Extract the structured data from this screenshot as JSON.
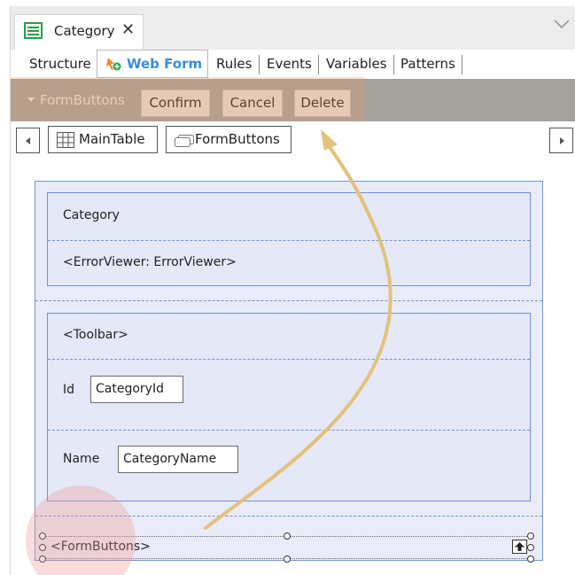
{
  "doc_tab": {
    "label": "Category",
    "close_glyph": "✕",
    "icon": "webpanel-icon"
  },
  "subtabs": {
    "structure": "Structure",
    "web_form": "Web Form",
    "rules": "Rules",
    "events": "Events",
    "variables": "Variables",
    "patterns": "Patterns"
  },
  "actionbar": {
    "title": "FormButtons",
    "buttons": [
      "Confirm",
      "Cancel",
      "Delete"
    ]
  },
  "breadcrumb": [
    "MainTable",
    "FormButtons"
  ],
  "form": {
    "category_label": "Category",
    "error_viewer": "<ErrorViewer: ErrorViewer>",
    "toolbar": "<Toolbar>",
    "id_label": "Id",
    "id_field": "CategoryId",
    "name_label": "Name",
    "name_field": "CategoryName",
    "form_buttons": "<FormButtons>"
  },
  "colors": {
    "accent": "#3a8ed8",
    "tab_icon": "#23a04a",
    "arrow": "#e3c27a",
    "actionbar": "#a5a19d"
  }
}
